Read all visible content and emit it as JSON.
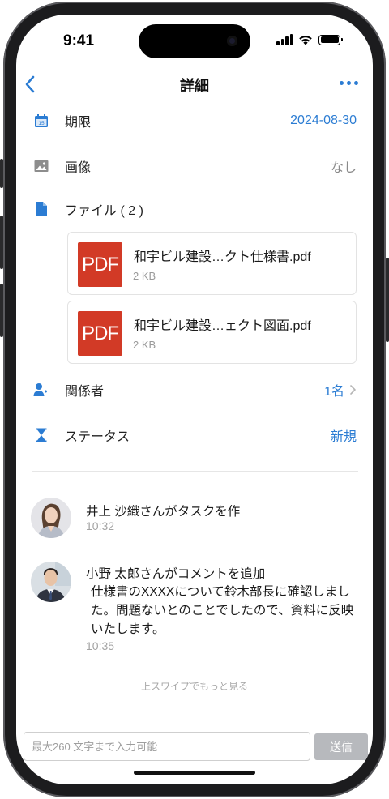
{
  "status_bar": {
    "time": "9:41"
  },
  "nav": {
    "title": "詳細"
  },
  "rows": {
    "deadline": {
      "label": "期限",
      "value": "2024-08-30"
    },
    "image": {
      "label": "画像",
      "value": "なし"
    },
    "files": {
      "label": "ファイル ( 2 )"
    },
    "members": {
      "label": "関係者",
      "value": "1名"
    },
    "status": {
      "label": "ステータス",
      "value": "新規"
    }
  },
  "files": [
    {
      "thumb": "PDF",
      "name": "和宇ビル建設…クト仕様書.pdf",
      "size": "2 KB"
    },
    {
      "thumb": "PDF",
      "name": "和宇ビル建設…ェクト図面.pdf",
      "size": "2 KB"
    }
  ],
  "activities": [
    {
      "title": "井上 沙織さんがタスクを作",
      "body": "",
      "time": "10:32"
    },
    {
      "title": "小野 太郎さんがコメントを追加",
      "body": "仕様書のXXXXについて鈴木部長に確認しました。問題ないとのことでしたので、資料に反映いたします。",
      "time": "10:35"
    }
  ],
  "more_hint": "上スワイプでもっと見る",
  "comment": {
    "placeholder": "最大260 文字まで入力可能",
    "value": "",
    "send_label": "送信"
  },
  "colors": {
    "accent": "#2b7cd3",
    "pdf_red": "#d23a26",
    "send_disabled": "#b7b9bd"
  },
  "icons": {
    "deadline": "calendar-icon",
    "image": "image-icon",
    "files": "file-icon",
    "members": "person-icon",
    "status": "hourglass-icon"
  }
}
